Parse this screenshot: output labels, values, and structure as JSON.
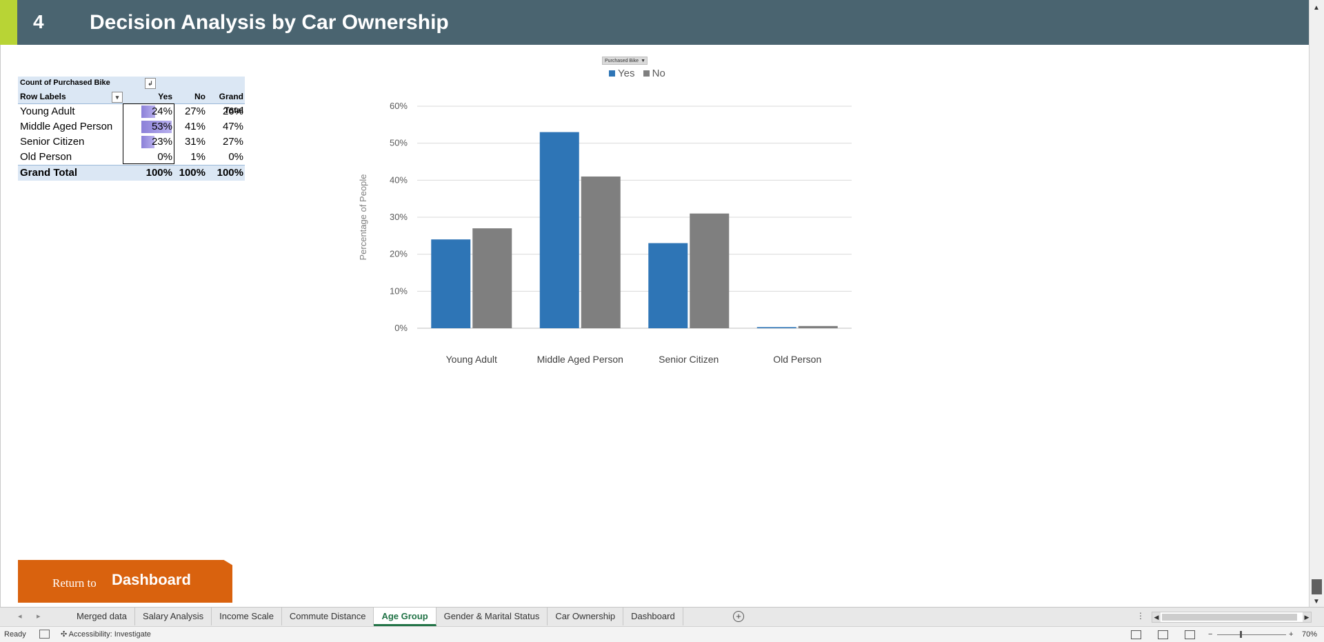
{
  "header": {
    "number": "4",
    "title": "Decision Analysis by Car Ownership"
  },
  "pivot": {
    "title": "Count of Purchased Bike",
    "row_labels_header": "Row Labels",
    "columns": [
      "Yes",
      "No",
      "Grand Total"
    ],
    "rows": [
      {
        "label": "Young Adult",
        "yes": "24%",
        "no": "27%",
        "total": "26%",
        "yes_value": 0.24
      },
      {
        "label": "Middle Aged Person",
        "yes": "53%",
        "no": "41%",
        "total": "47%",
        "yes_value": 0.53
      },
      {
        "label": "Senior Citizen",
        "yes": "23%",
        "no": "31%",
        "total": "27%",
        "yes_value": 0.23
      },
      {
        "label": "Old Person",
        "yes": "0%",
        "no": "1%",
        "total": "0%",
        "yes_value": 0.0
      }
    ],
    "grand_total": {
      "label": "Grand Total",
      "yes": "100%",
      "no": "100%",
      "total": "100%"
    },
    "databar_color": "#8b80d8",
    "header_bg": "#dbe7f4"
  },
  "chart_filter": {
    "label": "Purchased Bike"
  },
  "chart_data": {
    "type": "bar",
    "categories": [
      "Young Adult",
      "Middle Aged Person",
      "Senior Citizen",
      "Old Person"
    ],
    "series": [
      {
        "name": "Yes",
        "values": [
          24,
          53,
          23,
          0.3
        ],
        "color": "#2e75b6"
      },
      {
        "name": "No",
        "values": [
          27,
          41,
          31,
          0.6
        ],
        "color": "#7f7f7f"
      }
    ],
    "ylabel": "Percentage of People",
    "ylim": [
      0,
      60
    ],
    "yticks": [
      "0%",
      "10%",
      "20%",
      "30%",
      "40%",
      "50%",
      "60%"
    ],
    "grid": true,
    "legend": "top"
  },
  "return_button": {
    "small": "Return to",
    "big": "Dashboard",
    "color": "#d9620e"
  },
  "sheet_tabs": [
    {
      "label": "Merged data",
      "active": false
    },
    {
      "label": "Salary Analysis",
      "active": false
    },
    {
      "label": "Income Scale",
      "active": false
    },
    {
      "label": "Commute Distance",
      "active": false
    },
    {
      "label": "Age Group",
      "active": true
    },
    {
      "label": "Gender & Marital Status",
      "active": false
    },
    {
      "label": "Car Ownership",
      "active": false
    },
    {
      "label": "Dashboard",
      "active": false
    }
  ],
  "status": {
    "ready": "Ready",
    "accessibility": "Accessibility: Investigate",
    "zoom": "70%"
  },
  "colors": {
    "header": "#4a6470",
    "accent": "#b8d435",
    "active_tab": "#217346"
  }
}
